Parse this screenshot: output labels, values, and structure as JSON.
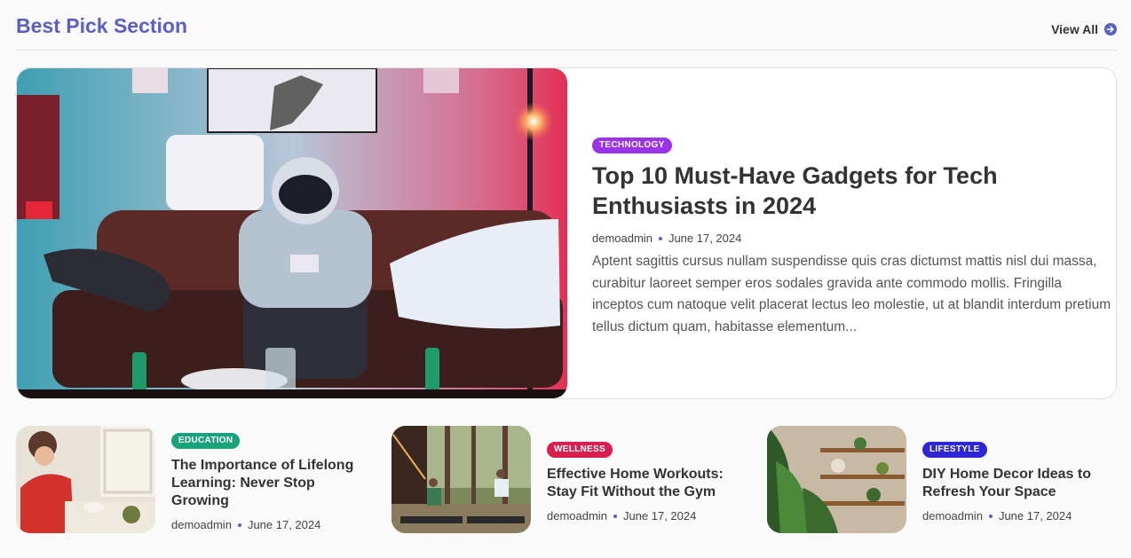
{
  "section": {
    "title": "Best Pick Section",
    "view_all": "View All"
  },
  "featured": {
    "category": "TECHNOLOGY",
    "category_color": "#9b33e8",
    "title": "Top 10 Must-Have Gadgets for Tech Enthusiasts in 2024",
    "author": "demoadmin",
    "date": "June 17, 2024",
    "excerpt": "Aptent sagittis cursus nullam suspendisse quis cras dictumst mattis nisl dui massa, curabitur laoreet semper eros sodales gravida ante commodo mollis. Fringilla inceptos cum natoque velit placerat lectus leo molestie, ut at blandit interdum pretium tellus dictum quam, habitasse elementum..."
  },
  "posts": [
    {
      "category": "EDUCATION",
      "category_color": "#1aa37a",
      "title": "The Importance of Lifelong Learning: Never Stop Growing",
      "author": "demoadmin",
      "date": "June 17, 2024"
    },
    {
      "category": "WELLNESS",
      "category_color": "#d81f4f",
      "title": "Effective Home Workouts: Stay Fit Without the Gym",
      "author": "demoadmin",
      "date": "June 17, 2024"
    },
    {
      "category": "LIFESTYLE",
      "category_color": "#2e25d6",
      "title": "DIY Home Decor Ideas to Refresh Your Space",
      "author": "demoadmin",
      "date": "June 17, 2024"
    }
  ],
  "icons": {
    "view_all": "arrow-right-circle-icon"
  }
}
